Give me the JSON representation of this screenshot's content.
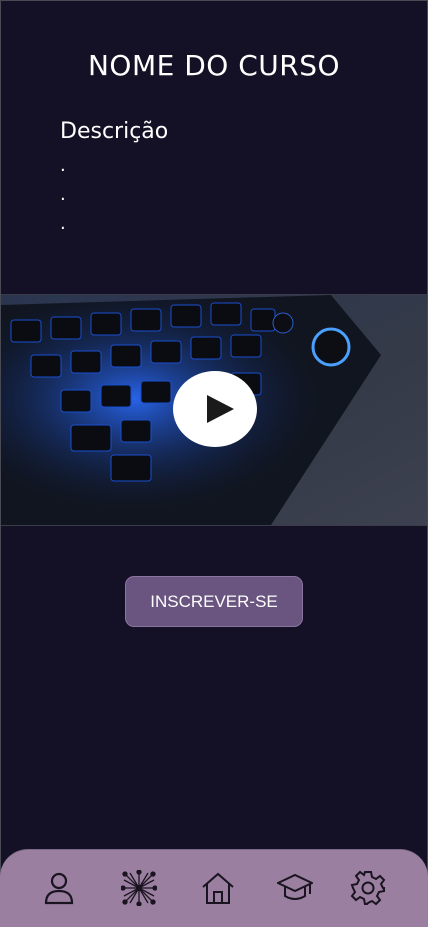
{
  "course": {
    "title": "NOME DO CURSO",
    "description_label": "Descrição",
    "bullets": [
      ".",
      ".",
      "."
    ]
  },
  "video": {
    "thumbnail": "keyboard-backlit-blue",
    "play_icon": "play-icon"
  },
  "enroll_button": {
    "label": "INSCREVER-SE"
  },
  "bottom_nav": {
    "items": [
      {
        "icon": "user-icon"
      },
      {
        "icon": "network-icon"
      },
      {
        "icon": "home-icon"
      },
      {
        "icon": "graduation-cap-icon"
      },
      {
        "icon": "gear-icon"
      }
    ]
  },
  "colors": {
    "background": "#141025",
    "accent": "#6a5480",
    "nav": "#9a7fa0"
  }
}
